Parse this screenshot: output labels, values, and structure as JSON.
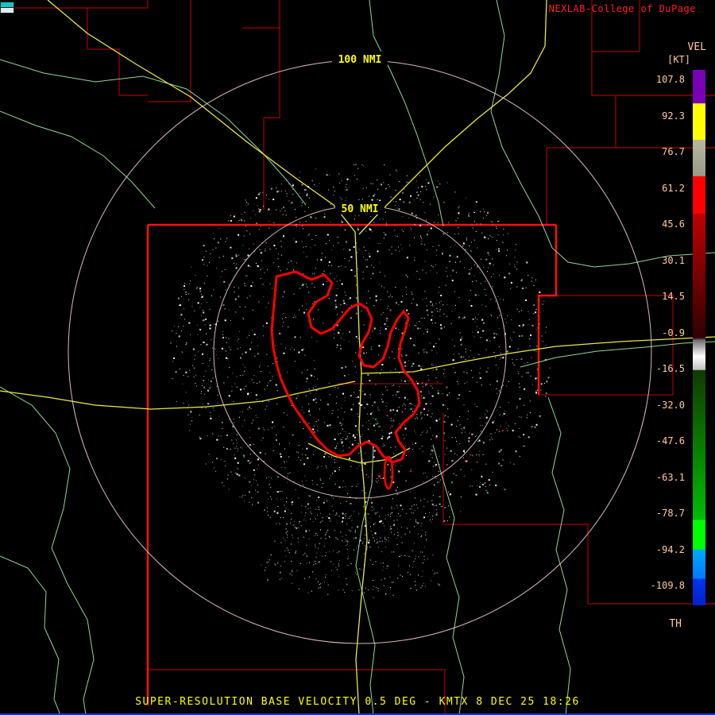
{
  "branding": {
    "text": "NEXLAB-College of DuPage"
  },
  "caption": {
    "text": "SUPER-RESOLUTION BASE VELOCITY 0.5 DEG - KMTX 8 DEC 25 18:26"
  },
  "rings": {
    "outer": "100 NMI",
    "inner": "50 NMI"
  },
  "colorbar": {
    "title": "VEL",
    "unit": "[KT]",
    "bottom_label": "TH",
    "ticks": [
      "107.8",
      "92.3",
      "76.7",
      "61.2",
      "45.6",
      "30.1",
      "14.5",
      "-0.9",
      "-16.5",
      "-32.0",
      "-47.6",
      "-63.1",
      "-78.7",
      "-94.2",
      "-109.8"
    ],
    "gradient": [
      {
        "o": 0.0,
        "c": "#7a00b8"
      },
      {
        "o": 0.062,
        "c": "#7a00b8"
      },
      {
        "o": 0.063,
        "c": "#ffff00"
      },
      {
        "o": 0.13,
        "c": "#ffff00"
      },
      {
        "o": 0.131,
        "c": "#b8b8a0"
      },
      {
        "o": 0.198,
        "c": "#9a9a88"
      },
      {
        "o": 0.199,
        "c": "#ff0000"
      },
      {
        "o": 0.268,
        "c": "#ff0000"
      },
      {
        "o": 0.269,
        "c": "#c00000"
      },
      {
        "o": 0.5,
        "c": "#300000"
      },
      {
        "o": 0.505,
        "c": "#707070"
      },
      {
        "o": 0.535,
        "c": "#ffffff"
      },
      {
        "o": 0.56,
        "c": "#c0c0c0"
      },
      {
        "o": 0.561,
        "c": "#123a00"
      },
      {
        "o": 0.84,
        "c": "#00bb00"
      },
      {
        "o": 0.841,
        "c": "#00ff00"
      },
      {
        "o": 0.895,
        "c": "#00ff00"
      },
      {
        "o": 0.896,
        "c": "#00aaff"
      },
      {
        "o": 0.95,
        "c": "#0077ff"
      },
      {
        "o": 0.951,
        "c": "#0033ee"
      },
      {
        "o": 1.0,
        "c": "#0022cc"
      }
    ]
  },
  "colors": {
    "background": "#000000",
    "county": "#c80000",
    "highlight_boundary": "#ff1010",
    "highway": "#e8e84a",
    "river": "#8fd69a",
    "range_ring": "#ffd9d9",
    "label_yellow": "#ffff00",
    "brand_red": "#ff2020",
    "tick_text": "#ffcc99",
    "lake_outline": "#ff0000"
  }
}
